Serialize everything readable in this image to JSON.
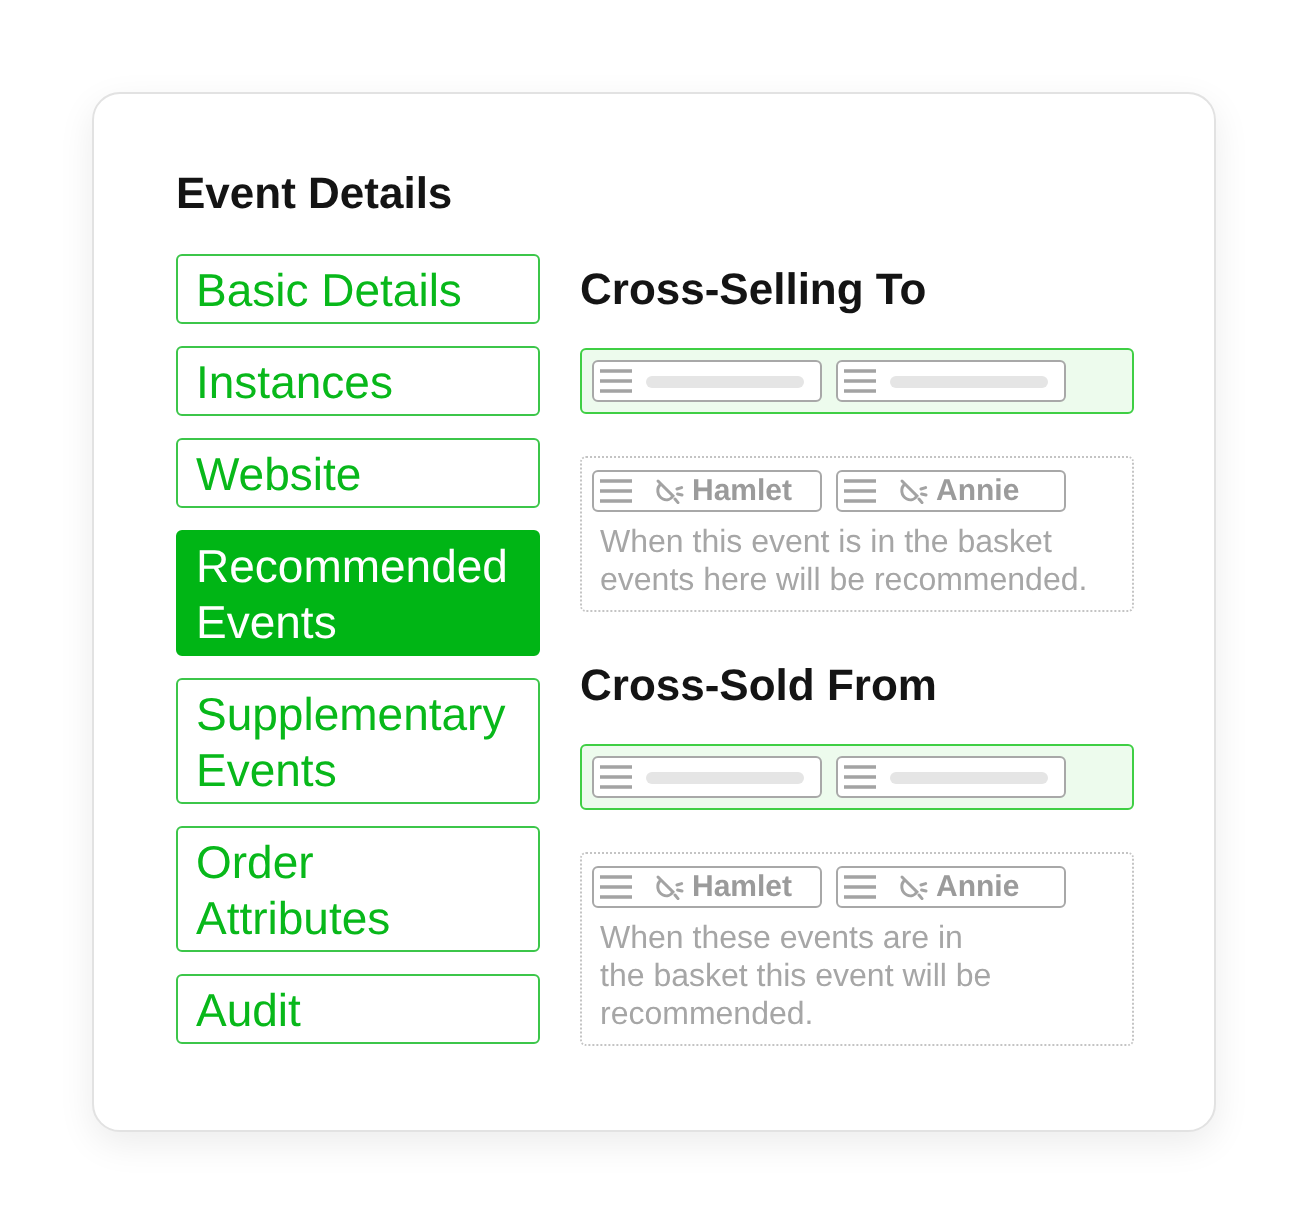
{
  "sidebar": {
    "title": "Event Details",
    "items": [
      {
        "label": "Basic Details",
        "selected": false
      },
      {
        "label": "Instances",
        "selected": false
      },
      {
        "label": "Website",
        "selected": false
      },
      {
        "label": "Recommended Events",
        "selected": true
      },
      {
        "label": "Supplementary Events",
        "selected": false
      },
      {
        "label": "Order Attributes",
        "selected": false
      },
      {
        "label": "Audit",
        "selected": false
      }
    ]
  },
  "sections": [
    {
      "title": "Cross-Selling To",
      "zones": [
        {
          "active": true,
          "chips": [
            {
              "kind": "placeholder"
            },
            {
              "kind": "placeholder"
            }
          ]
        },
        {
          "active": false,
          "chips": [
            {
              "kind": "event",
              "label": "Hamlet"
            },
            {
              "kind": "event",
              "label": "Annie"
            }
          ],
          "note_lines": [
            "When this event is in the basket",
            "events here will be recommended."
          ]
        }
      ]
    },
    {
      "title": "Cross-Sold From",
      "zones": [
        {
          "active": true,
          "chips": [
            {
              "kind": "placeholder"
            },
            {
              "kind": "placeholder"
            }
          ]
        },
        {
          "active": false,
          "chips": [
            {
              "kind": "event",
              "label": "Hamlet"
            },
            {
              "kind": "event",
              "label": "Annie"
            }
          ],
          "note_lines": [
            "When these events are in",
            "the basket this event will be",
            "recommended."
          ]
        }
      ]
    }
  ]
}
